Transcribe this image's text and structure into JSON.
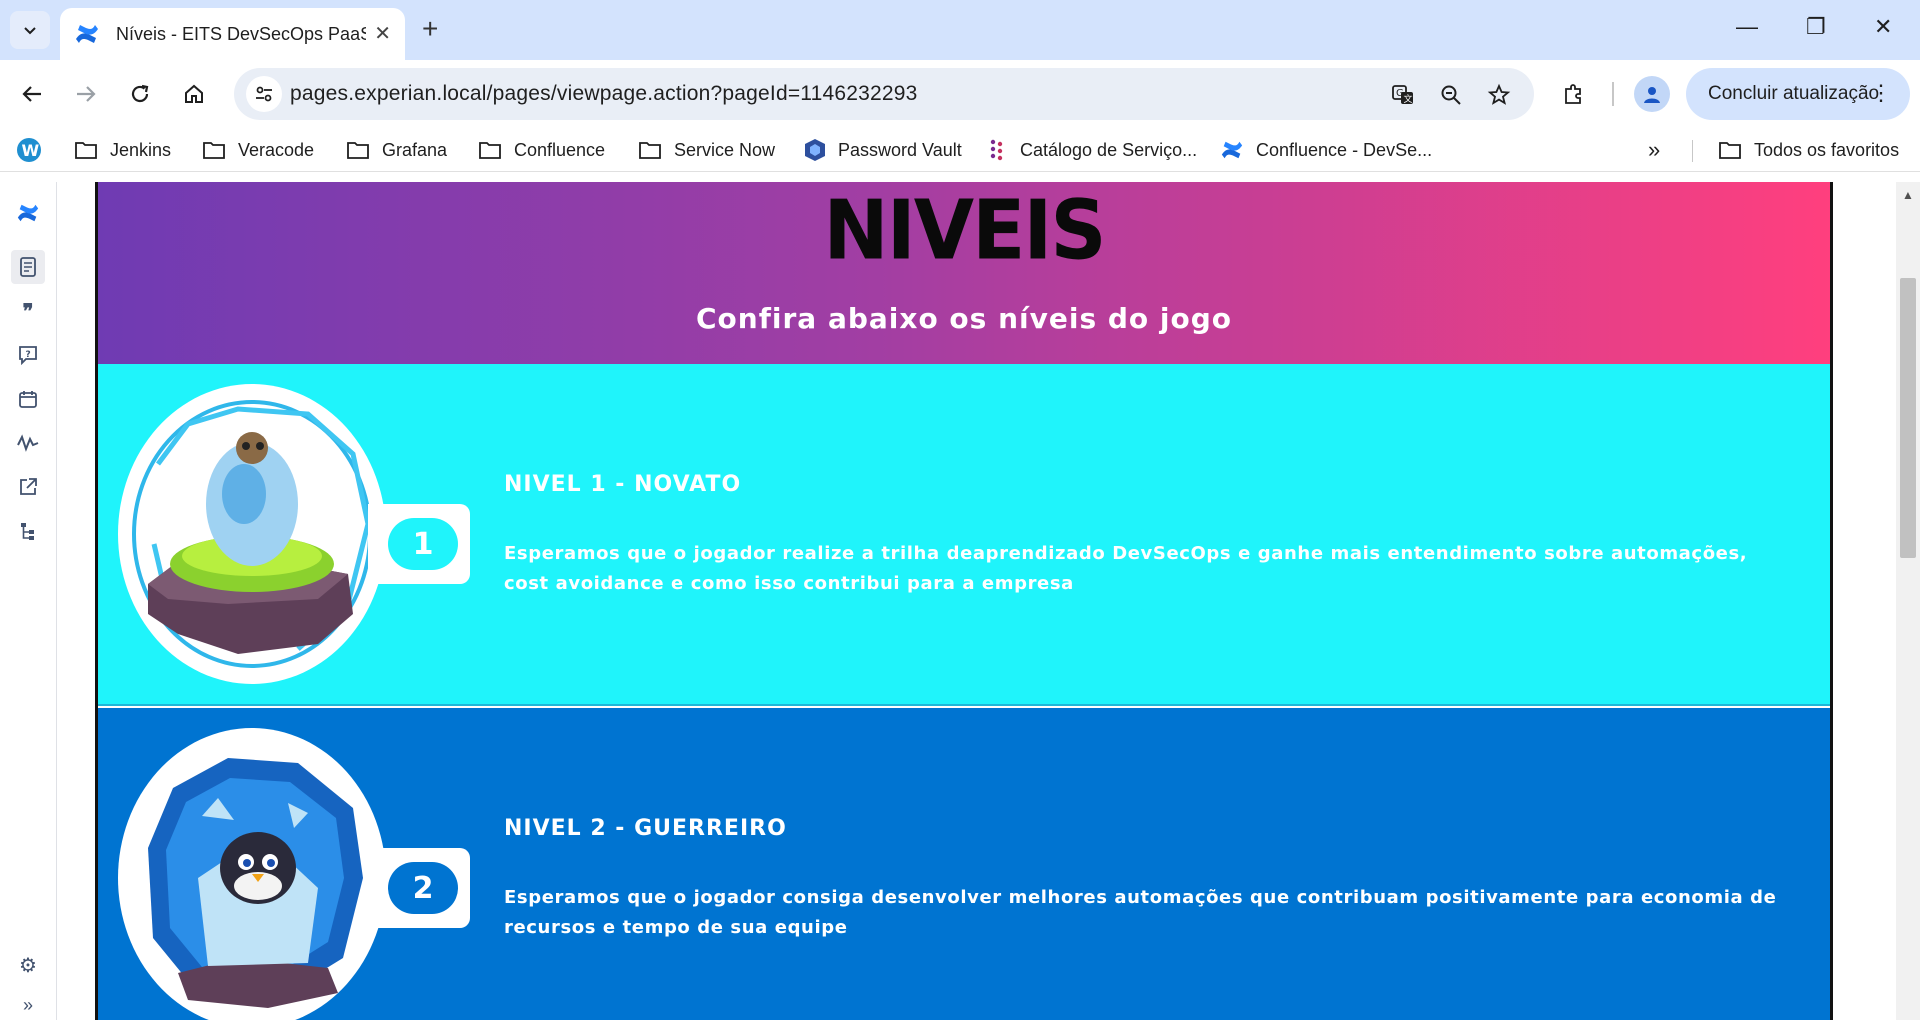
{
  "browser": {
    "tab": {
      "title": "Níveis - EITS DevSecOps PaaS B"
    },
    "url": "pages.experian.local/pages/viewpage.action?pageId=1146232293",
    "update_button": "Concluir atualização",
    "bookmarks": [
      {
        "label": "Jenkins",
        "icon": "folder-icon"
      },
      {
        "label": "Veracode",
        "icon": "folder-icon"
      },
      {
        "label": "Grafana",
        "icon": "folder-icon"
      },
      {
        "label": "Confluence",
        "icon": "folder-icon"
      },
      {
        "label": "Service Now",
        "icon": "folder-icon"
      },
      {
        "label": "Password Vault",
        "icon": "vault-icon"
      },
      {
        "label": "Catálogo de Serviço...",
        "icon": "servicenow-icon"
      },
      {
        "label": "Confluence - DevSe...",
        "icon": "confluence-icon"
      }
    ],
    "all_bookmarks": "Todos os favoritos"
  },
  "sidebar": {
    "items": [
      "confluence-logo",
      "page-icon",
      "quote-icon",
      "feedback-icon",
      "calendar-icon",
      "analytics-icon",
      "external-link-icon",
      "hierarchy-icon"
    ],
    "bottom": [
      "settings-icon",
      "expand-icon"
    ]
  },
  "page": {
    "hero_title": "NIVEIS",
    "hero_subtitle": "Confira abaixo os níveis do jogo",
    "levels": [
      {
        "number": "1",
        "title": "NIVEL 1 - NOVATO",
        "description": "Esperamos que o jogador realize a trilha deaprendizado DevSecOps e ganhe mais entendimento sobre automações, cost avoidance e como isso contribui para a empresa",
        "color": "#1ff4fb"
      },
      {
        "number": "2",
        "title": "NIVEL 2 - GUERREIRO",
        "description": "Esperamos que o jogador consiga desenvolver melhores automações que contribuam positivamente para economia de recursos e tempo de sua equipe",
        "color": "#0074d1"
      }
    ]
  },
  "colors": {
    "hero_gradient_start": "#6f3bb3",
    "hero_gradient_end": "#ff3f7e",
    "level1_bg": "#1ff4fb",
    "level2_bg": "#0074d1"
  }
}
